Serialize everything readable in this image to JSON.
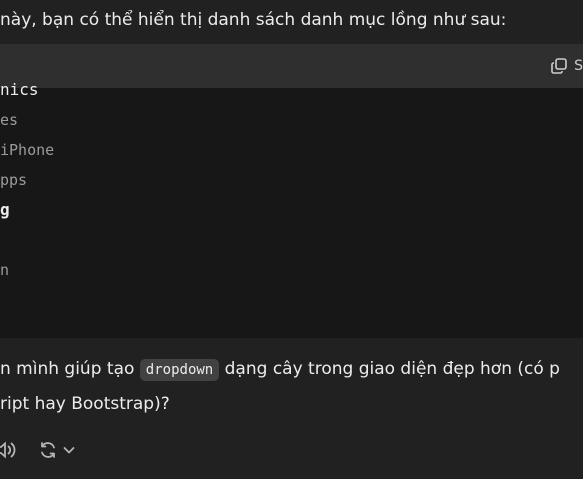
{
  "intro_text": "này, bạn có thể hiển thị danh sách danh mục lồng như sau:",
  "code": {
    "copy_label": "S",
    "lines": [
      "nics",
      "es",
      "iPhone",
      "pps",
      "g",
      "",
      "n"
    ]
  },
  "paragraph": {
    "before": "n mình giúp tạo ",
    "code": "dropdown",
    "after": " dạng cây trong giao diện đẹp hơn (có p",
    "line2": "ript hay Bootstrap)?"
  },
  "icons": {
    "copy": "copy-icon",
    "speaker": "speaker-icon",
    "regenerate": "regenerate-icon",
    "chevron": "chevron-down-icon"
  }
}
